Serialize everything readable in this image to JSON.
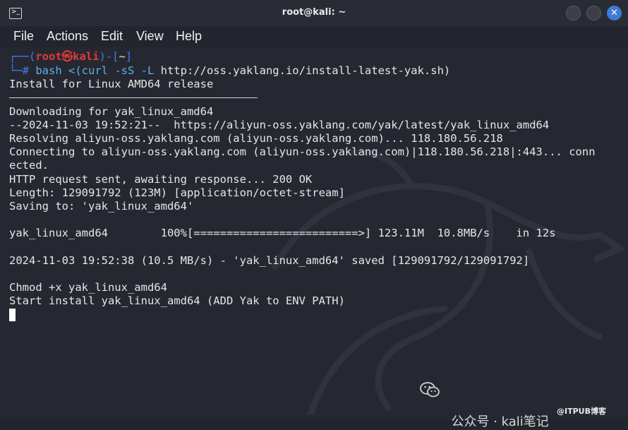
{
  "window": {
    "title": "root@kali: ~",
    "close_glyph": "✕"
  },
  "menu": {
    "items": [
      "File",
      "Actions",
      "Edit",
      "View",
      "Help"
    ]
  },
  "prompt": {
    "open": "┌──(",
    "user": "root㉿kali",
    "mid": ")-[",
    "dir": "~",
    "close": "]",
    "hash": "└─#",
    "cmd": " bash <(curl -sS -L ",
    "url": "http://oss.yaklang.io/install-latest-yak.sh)"
  },
  "output": [
    "Install for Linux AMD64 release",
    "Downloading for yak_linux_amd64",
    "--2024-11-03 19:52:21--  https://aliyun-oss.yaklang.com/yak/latest/yak_linux_amd64",
    "Resolving aliyun-oss.yaklang.com (aliyun-oss.yaklang.com)... 118.180.56.218",
    "Connecting to aliyun-oss.yaklang.com (aliyun-oss.yaklang.com)|118.180.56.218|:443... connected.",
    "ected.",
    "HTTP request sent, awaiting response... 200 OK",
    "Length: 129091792 (123M) [application/octet-stream]",
    "Saving to: 'yak_linux_amd64'",
    "yak_linux_amd64        100%[=========================>] 123.11M  10.8MB/s    in 12s",
    "2024-11-03 19:52:38 (10.5 MB/s) - 'yak_linux_amd64' saved [129091792/129091792]",
    "Chmod +x yak_linux_amd64",
    "Start install yak_linux_amd64 (ADD Yak to ENV PATH)"
  ],
  "watermark": {
    "text": "公众号 · kali笔记",
    "icon": "wechat-icon"
  },
  "credit": "@ITPUB博客",
  "colors": {
    "background": "#262831",
    "prompt_frame": "#3f7ee8",
    "prompt_user": "#e03a3a",
    "command": "#5bb1e8",
    "close_button": "#3d7bd6"
  }
}
